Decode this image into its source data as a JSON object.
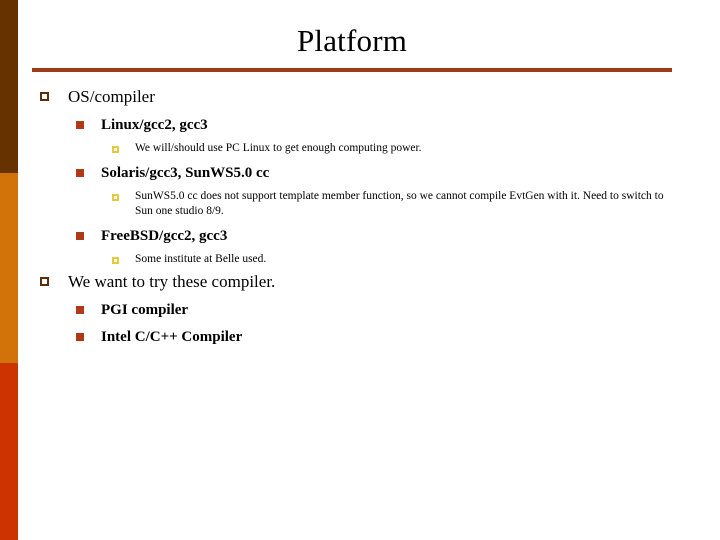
{
  "slide": {
    "title": "Platform",
    "background_color": "#FFFFFF",
    "rule_color": "#9E3B1B",
    "title_color": "#000000"
  },
  "sidebar": {
    "bands": [
      {
        "name": "band-dark-brown",
        "color": "#663300"
      },
      {
        "name": "band-orange",
        "color": "#D2730A"
      },
      {
        "name": "band-red-orange",
        "color": "#CC3300"
      }
    ]
  },
  "markers": {
    "level1": {
      "name": "hollow-square-bullet-icon",
      "color": "#5C2E0B",
      "style": "outline"
    },
    "level2": {
      "name": "filled-square-bullet-icon",
      "color": "#B03A18",
      "style": "filled"
    },
    "level3": {
      "name": "hollow-square-small-bullet-icon",
      "color": "#E8C93C",
      "style": "outline"
    }
  },
  "outline": {
    "item1": {
      "label": "OS/compiler",
      "sub1": {
        "label": "Linux/gcc2, gcc3",
        "detail1": "We will/should use PC Linux to get enough computing power."
      },
      "sub2": {
        "label": "Solaris/gcc3, SunWS5.0 cc",
        "detail1": "SunWS5.0 cc does not support template member function, so we cannot compile EvtGen with it. Need to switch to Sun one studio 8/9."
      },
      "sub3": {
        "label": "FreeBSD/gcc2, gcc3",
        "detail1": "Some institute at Belle used."
      }
    },
    "item2": {
      "label": "We want to try these compiler.",
      "sub1": {
        "label": "PGI compiler"
      },
      "sub2": {
        "label": "Intel C/C++ Compiler"
      }
    }
  }
}
